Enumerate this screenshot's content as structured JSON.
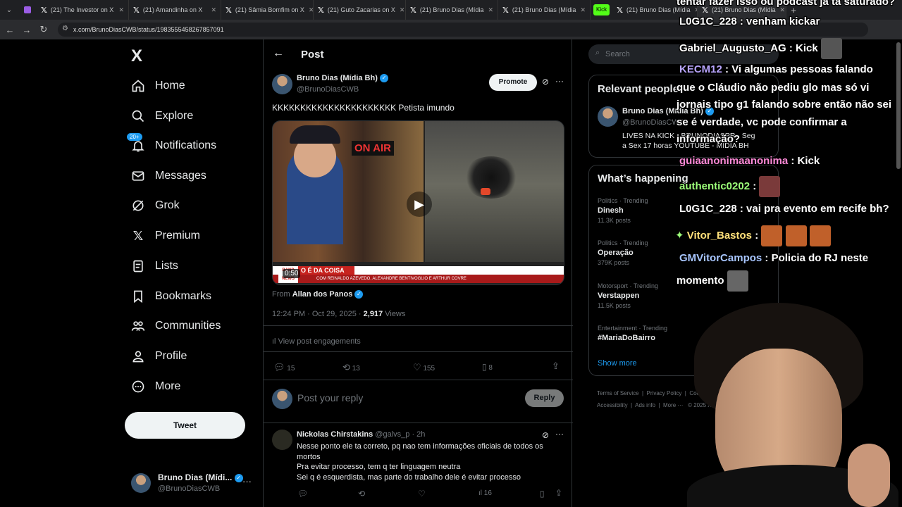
{
  "browser": {
    "tabs": [
      {
        "label": "(21) The Investor on X"
      },
      {
        "label": "(21) Amandinha on X"
      },
      {
        "label": "(21) Sâmia Bomfim on X"
      },
      {
        "label": "(21) Guto Zacarias on X"
      },
      {
        "label": "(21) Bruno Dias (Mídia"
      },
      {
        "label": "(21) Bruno Dias (Mídia"
      },
      {
        "label": "(21) Bruno Dias (Mídia"
      },
      {
        "label": "(21) Bruno Dias (Mídia"
      }
    ],
    "kick_badge": "Kick",
    "url": "x.com/BrunoDiasCWB/status/1983555458267857091"
  },
  "nav": {
    "logo": "X",
    "items": [
      {
        "label": "Home",
        "icon": "home-icon"
      },
      {
        "label": "Explore",
        "icon": "search-icon"
      },
      {
        "label": "Notifications",
        "icon": "bell-icon",
        "badge": "20+"
      },
      {
        "label": "Messages",
        "icon": "mail-icon"
      },
      {
        "label": "Grok",
        "icon": "grok-icon"
      },
      {
        "label": "Premium",
        "icon": "x-icon"
      },
      {
        "label": "Lists",
        "icon": "list-icon"
      },
      {
        "label": "Bookmarks",
        "icon": "bookmark-icon"
      },
      {
        "label": "Communities",
        "icon": "people-icon"
      },
      {
        "label": "Profile",
        "icon": "person-icon"
      },
      {
        "label": "More",
        "icon": "more-circle-icon"
      }
    ],
    "tweet_button": "Tweet",
    "account": {
      "name": "Bruno Dias (Mídi...",
      "handle": "@BrunoDiasCWB"
    }
  },
  "header": {
    "title": "Post"
  },
  "post": {
    "author": "Bruno Dias (Mídia Bh)",
    "handle": "@BrunoDiasCWB",
    "promote": "Promote",
    "text": "KKKKKKKKKKKKKKKKKKKKKK Petista imundo",
    "video": {
      "duration": "0:50",
      "banner": "O É DA COISA",
      "on_air": "ON AIR",
      "logo": "BAND NEWS",
      "subtitle": "COM REINALDO AZEVEDO, ALEXANDRE BENTIVOGLIO E ARTHUR COVRE"
    },
    "from_label": "From",
    "from_name": "Allan dos Panos",
    "time": "12:24 PM · Oct 29, 2025 ·",
    "views_count": "2,917",
    "views_label": "Views",
    "engagements": "View post engagements",
    "stats": {
      "replies": "15",
      "reposts": "13",
      "likes": "155",
      "bookmarks": "8"
    }
  },
  "reply_box": {
    "placeholder": "Post your reply",
    "button": "Reply"
  },
  "reply": {
    "author": "Nickolas Chirstakins",
    "handle": "@galvs_p",
    "time": "· 2h",
    "lines": [
      "Nesse ponto ele ta correto, pq nao tem informações oficiais de todos os",
      "mortos",
      "Pra evitar processo, tem q ter linguagem neutra",
      "Sei q é esquerdista, mas parte do trabalho dele é evitar processo"
    ],
    "views": "16"
  },
  "sidebar": {
    "search_placeholder": "Search",
    "relevant_title": "Relevant people",
    "relevant_person": {
      "name": "Bruno Dias (Mídia Bh)",
      "handle": "@BrunoDiasCWB",
      "bio1": "LIVES NA KICK - BRUNODIASPR - Seg",
      "bio2": "a Sex 17 horas YOUTUBE - MÍDIA BH"
    },
    "happening_title": "What’s happening",
    "trends": [
      {
        "category": "Politics · Trending",
        "name": "Dinesh",
        "posts": "11.3K posts"
      },
      {
        "category": "Politics · Trending",
        "name": "Operação",
        "posts": "379K posts"
      },
      {
        "category": "Motorsport · Trending",
        "name": "Verstappen",
        "posts": "11.5K posts"
      },
      {
        "category": "Entertainment · Trending",
        "name": "#MariaDoBairro",
        "posts": ""
      }
    ],
    "show_more": "Show more",
    "footer": [
      "Terms of Service",
      "Privacy Policy",
      "Cookie Policy",
      "Accessibility",
      "Ads info",
      "More ···",
      "© 2025 X Corp."
    ]
  },
  "chat": [
    {
      "user": "tentar fazer isso ou podcast já tá saturado?",
      "msg": "",
      "color": "#ffffff"
    },
    {
      "user": "L0G1C_228",
      "msg": ": venham kickar",
      "color": "#ffffff"
    },
    {
      "user": "Gabriel_Augusto_AG",
      "msg": ": Kick",
      "color": "#ffffff"
    },
    {
      "user": "KECM12",
      "msg": ": Vi algumas pessoas falando",
      "color": "#b9a6ff"
    },
    {
      "user": "",
      "msg": "que o Cláudio não pediu glo mas só vi",
      "color": "#ffffff"
    },
    {
      "user": "",
      "msg": "jornais tipo g1 falando sobre então não sei",
      "color": "#ffffff"
    },
    {
      "user": "",
      "msg": "se é verdade, vc pode confirmar a",
      "color": "#ffffff"
    },
    {
      "user": "",
      "msg": "informação?",
      "color": "#ffffff"
    },
    {
      "user": "guiaanonimaanonima",
      "msg": ": Kick",
      "color": "#ff8ad8"
    },
    {
      "user": "authentic0202",
      "msg": ":",
      "color": "#9dff7a"
    },
    {
      "user": "L0G1C_228",
      "msg": ": vai pra evento em recife bh?",
      "color": "#ffffff"
    },
    {
      "user": "Vitor_Bastos",
      "msg": ":",
      "color": "#ffe07a"
    },
    {
      "user": "GMVitorCampos",
      "msg": ": Policia do RJ neste",
      "color": "#a8c6ff"
    },
    {
      "user": "",
      "msg": "momento",
      "color": "#ffffff"
    }
  ]
}
